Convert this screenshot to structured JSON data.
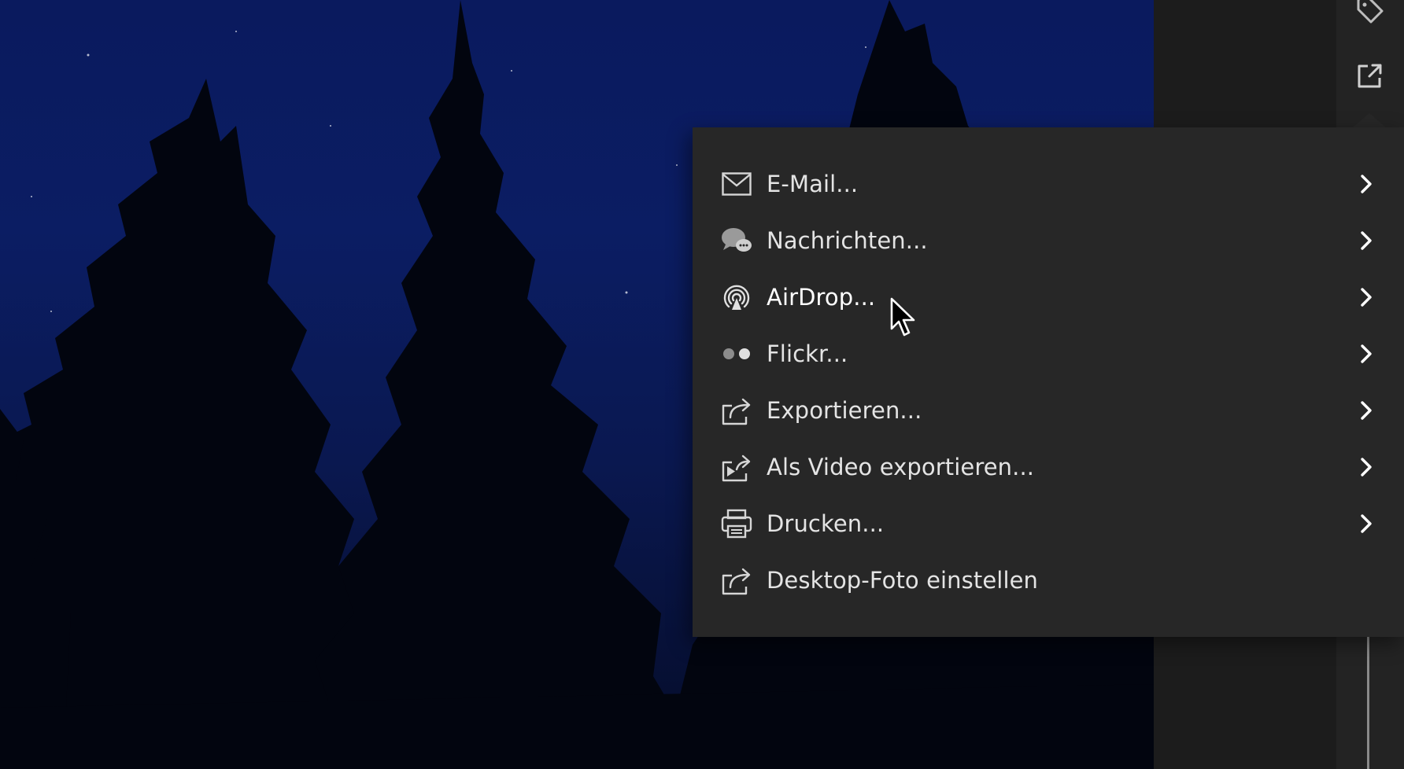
{
  "toolbar": {
    "tag_icon": "tag-icon",
    "share_icon": "share-out-icon"
  },
  "share_menu": {
    "items": [
      {
        "label": "E-Mail...",
        "icon": "envelope-icon",
        "has_submenu": true
      },
      {
        "label": "Nachrichten...",
        "icon": "messages-bubble-icon",
        "has_submenu": true
      },
      {
        "label": "AirDrop...",
        "icon": "airdrop-icon",
        "has_submenu": true
      },
      {
        "label": "Flickr...",
        "icon": "flickr-dots-icon",
        "has_submenu": true
      },
      {
        "label": "Exportieren...",
        "icon": "export-arrow-icon",
        "has_submenu": true
      },
      {
        "label": "Als Video exportieren...",
        "icon": "video-export-icon",
        "has_submenu": true
      },
      {
        "label": "Drucken...",
        "icon": "printer-icon",
        "has_submenu": true
      },
      {
        "label": "Desktop-Foto einstellen",
        "icon": "desktop-set-icon",
        "has_submenu": false
      }
    ]
  },
  "colors": {
    "menu_bg": "#272727",
    "menu_text": "#e4e4e4",
    "sky": "#0b1d63",
    "panel": "#1c1c1c"
  }
}
